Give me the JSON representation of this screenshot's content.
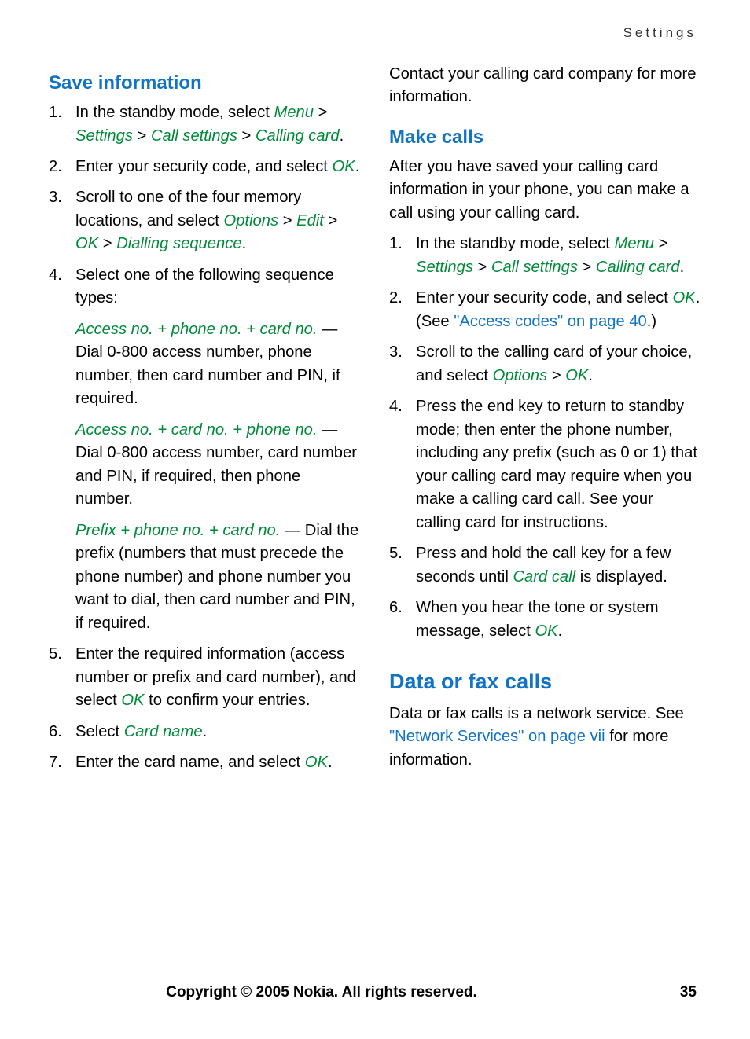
{
  "header": "Settings",
  "left": {
    "h_save": "Save information",
    "s1": {
      "n": "1.",
      "pre": "In the standby mode, select ",
      "m": "Menu",
      "g1": " > ",
      "s": "Settings",
      "g2": " > ",
      "c": "Call settings",
      "g3": " > ",
      "cc": "Calling card",
      "dot": "."
    },
    "s2": {
      "n": "2.",
      "a": "Enter your security code, and select ",
      "ok": "OK",
      "dot": "."
    },
    "s3": {
      "n": "3.",
      "a": "Scroll to one of the four memory locations, and select ",
      "opt": "Options",
      "g1": " > ",
      "ed": "Edit",
      "g2": " > ",
      "ok": "OK",
      "g3": " > ",
      "ds": "Dialling sequence",
      "dot": "."
    },
    "s4": {
      "n": "4.",
      "a": "Select one of the following sequence types:"
    },
    "seq1": {
      "t": "Access no. + phone no. + card no.",
      "b": " — Dial 0-800 access number, phone number, then card number and PIN, if required."
    },
    "seq2": {
      "t": "Access no. + card no. + phone no.",
      "b": " — Dial 0-800 access number, card number and PIN, if required, then phone number."
    },
    "seq3": {
      "t": "Prefix + phone no. + card no.",
      "b": " — Dial the prefix (numbers that must precede the phone number) and phone number you want to dial, then card number and PIN, if required."
    },
    "s5": {
      "n": "5.",
      "a": "Enter the required information (access number or prefix and card number), and select ",
      "ok": "OK",
      "b": " to confirm your entries."
    },
    "s6": {
      "n": "6.",
      "a": "Select ",
      "cn": "Card name",
      "dot": "."
    },
    "s7": {
      "n": "7.",
      "a": "Enter the card name, and select ",
      "ok": "OK",
      "dot": "."
    }
  },
  "right": {
    "p1": "Contact your calling card company for more information.",
    "h_make": "Make calls",
    "p2": "After you have saved your calling card information in your phone, you can make a call using your calling card.",
    "m1": {
      "n": "1.",
      "a": "In the standby mode, select ",
      "m": "Menu",
      "g1": " > ",
      "s": "Settings",
      "g2": " > ",
      "c": "Call settings",
      "g3": " > ",
      "cc": "Calling card",
      "dot": "."
    },
    "m2": {
      "n": "2.",
      "a": "Enter your security code, and select ",
      "ok": "OK",
      "b": ". (See ",
      "lk": "\"Access codes\" on page 40",
      "c": ".)"
    },
    "m3": {
      "n": "3.",
      "a": "Scroll to the calling card of your choice, and select ",
      "opt": "Options",
      "g1": " > ",
      "ok": "OK",
      "dot": "."
    },
    "m4": {
      "n": "4.",
      "a": "Press the end key to return to standby mode; then enter the phone number, including any prefix (such as 0 or 1) that your calling card may require when you make a calling card call. See your calling card for instructions."
    },
    "m5": {
      "n": "5.",
      "a": "Press and hold the call key for a few seconds until ",
      "cc": "Card call",
      "b": " is displayed."
    },
    "m6": {
      "n": "6.",
      "a": "When you hear the tone or system message, select ",
      "ok": "OK",
      "dot": "."
    },
    "h_data": "Data or fax calls",
    "p3a": "Data or fax calls is a network service. See ",
    "p3b": "\"Network Services\" on page vii",
    "p3c": " for more information."
  },
  "footer": {
    "copy": "Copyright © 2005 Nokia. All rights reserved.",
    "pg": "35"
  }
}
